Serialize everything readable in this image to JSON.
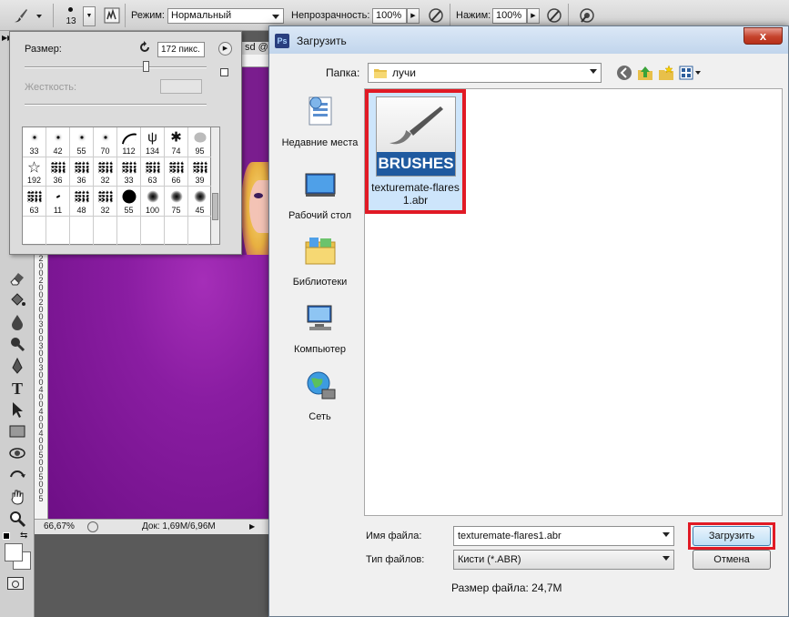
{
  "options_bar": {
    "brush_size": "13",
    "mode_label": "Режим:",
    "mode_value": "Нормальный",
    "opacity_label": "Непрозрачность:",
    "opacity_value": "100%",
    "flow_label": "Нажим:",
    "flow_value": "100%"
  },
  "brush_panel": {
    "size_label": "Размер:",
    "size_value": "172 пикс.",
    "hardness_label": "Жесткость:",
    "presets": [
      {
        "n": "33",
        "shape": "dot"
      },
      {
        "n": "42",
        "shape": "dot"
      },
      {
        "n": "55",
        "shape": "dot"
      },
      {
        "n": "70",
        "shape": "dot"
      },
      {
        "n": "112",
        "shape": "stroke"
      },
      {
        "n": "134",
        "shape": "grass"
      },
      {
        "n": "74",
        "shape": "leaf"
      },
      {
        "n": "95",
        "shape": "blob"
      },
      {
        "n": "192",
        "shape": "star"
      },
      {
        "n": "36",
        "shape": "spatter"
      },
      {
        "n": "36",
        "shape": "spatter"
      },
      {
        "n": "32",
        "shape": "spatter"
      },
      {
        "n": "33",
        "shape": "spatter"
      },
      {
        "n": "63",
        "shape": "spatter"
      },
      {
        "n": "66",
        "shape": "spatter"
      },
      {
        "n": "39",
        "shape": "spatter"
      },
      {
        "n": "63",
        "shape": "spatter"
      },
      {
        "n": "11",
        "shape": "dash"
      },
      {
        "n": "48",
        "shape": "spatter"
      },
      {
        "n": "32",
        "shape": "spatter"
      },
      {
        "n": "55",
        "shape": "solid"
      },
      {
        "n": "100",
        "shape": "soft"
      },
      {
        "n": "75",
        "shape": "soft"
      },
      {
        "n": "45",
        "shape": "soft"
      },
      {
        "n": "",
        "shape": ""
      },
      {
        "n": "",
        "shape": ""
      },
      {
        "n": "",
        "shape": ""
      },
      {
        "n": "",
        "shape": ""
      },
      {
        "n": "",
        "shape": ""
      },
      {
        "n": "",
        "shape": ""
      },
      {
        "n": "",
        "shape": ""
      },
      {
        "n": "",
        "shape": ""
      }
    ]
  },
  "document": {
    "tab_label": "sd @",
    "zoom": "66,67%",
    "doc_info": "Док: 1,69M/6,96M",
    "ruler_marks": [
      "2",
      "0",
      "0",
      "2",
      "0",
      "0",
      "2",
      "0",
      "0",
      "3",
      "0",
      "0",
      "3",
      "0",
      "0",
      "3",
      "0",
      "0",
      "4",
      "0",
      "0",
      "4",
      "0",
      "0",
      "4",
      "0",
      "0",
      "5",
      "0",
      "0",
      "5",
      "0",
      "0",
      "5"
    ]
  },
  "dialog": {
    "title": "Загрузить",
    "close_label": "x",
    "folder_label": "Папка:",
    "folder_value": "лучи",
    "places": [
      {
        "label": "Недавние места",
        "icon": "recent-places-icon"
      },
      {
        "label": "Рабочий стол",
        "icon": "desktop-icon"
      },
      {
        "label": "Библиотеки",
        "icon": "libraries-icon"
      },
      {
        "label": "Компьютер",
        "icon": "computer-icon"
      },
      {
        "label": "Сеть",
        "icon": "network-icon"
      }
    ],
    "file": {
      "thumb_text": "BRUSHES",
      "name_line1": "texturemate-flares",
      "name_line2": "1.abr"
    },
    "filename_label": "Имя файла:",
    "filename_value": "texturemate-flares1.abr",
    "filetype_label": "Тип файлов:",
    "filetype_value": "Кисти (*.ABR)",
    "load_button": "Загрузить",
    "cancel_button": "Отмена",
    "filesize_text": "Размер файла: 24,7M"
  },
  "colors": {
    "highlight": "#e11a25",
    "canvas": "#8a1da2",
    "selection": "#cde5fb",
    "brush_banner": "#1f5aa0"
  }
}
